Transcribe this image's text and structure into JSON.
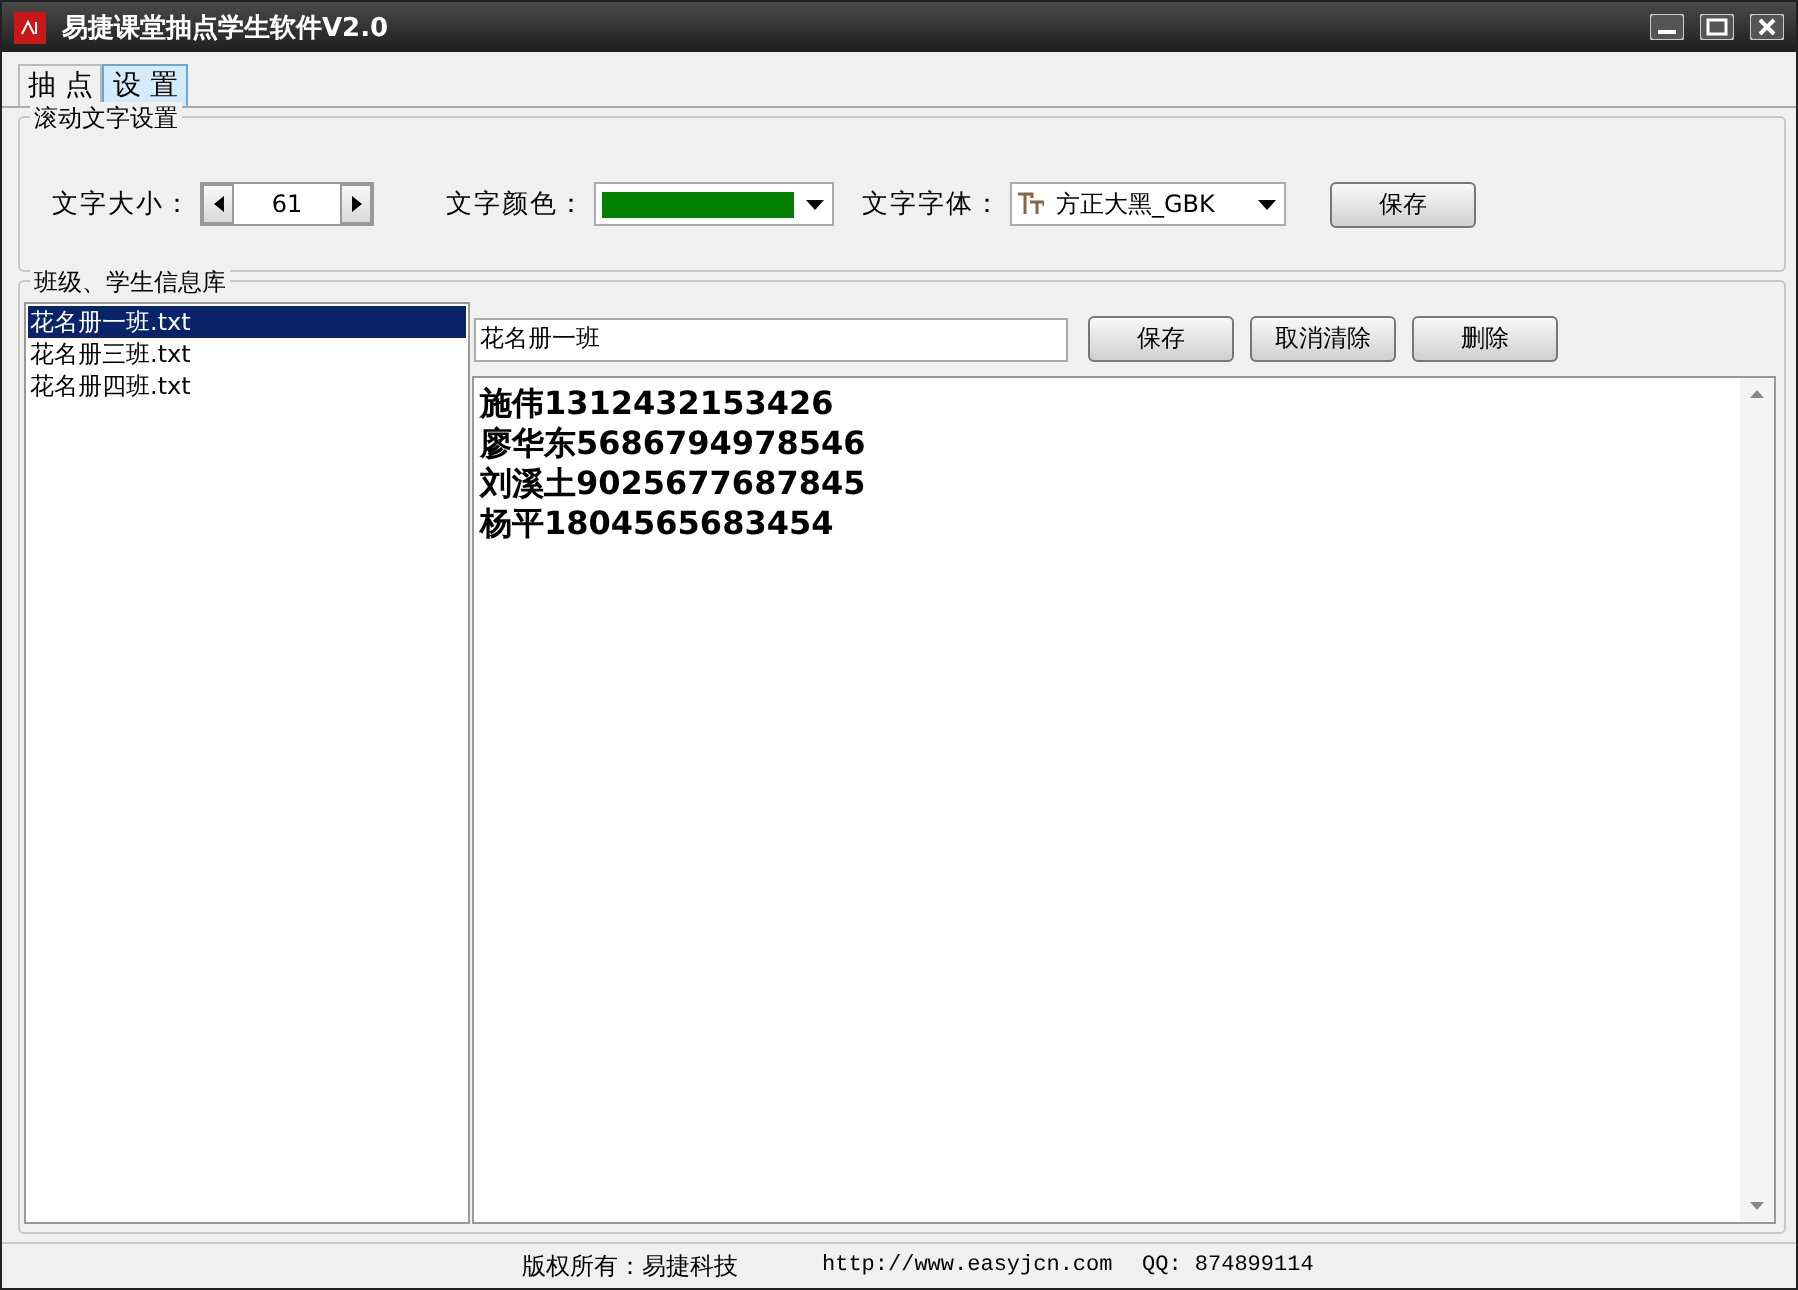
{
  "window": {
    "title": "易捷课堂抽点学生软件V2.0"
  },
  "tabs": [
    {
      "label": "抽 点",
      "selected": false
    },
    {
      "label": "设 置",
      "selected": true
    }
  ],
  "scroll_settings": {
    "title": "滚动文字设置",
    "size_label": "文字大小：",
    "size_value": "61",
    "color_label": "文字颜色：",
    "color": "#008000",
    "font_label": "文字字体：",
    "font_value": "方正大黑_GBK",
    "save": "保存"
  },
  "library": {
    "title": "班级、学生信息库",
    "files": [
      {
        "name": "花名册一班.txt",
        "selected": true
      },
      {
        "name": "花名册三班.txt",
        "selected": false
      },
      {
        "name": "花名册四班.txt",
        "selected": false
      }
    ],
    "name_value": "花名册一班",
    "buttons": [
      "保存",
      "取消清除",
      "删除"
    ],
    "students": [
      "施伟1312432153426",
      "廖华东5686794978546",
      "刘溪土9025677687845",
      "杨平1804565683454"
    ]
  },
  "status_bar": {
    "copyright": "版权所有：易捷科技",
    "url": "http://www.easyjcn.com",
    "qq": "QQ: 874899114"
  }
}
